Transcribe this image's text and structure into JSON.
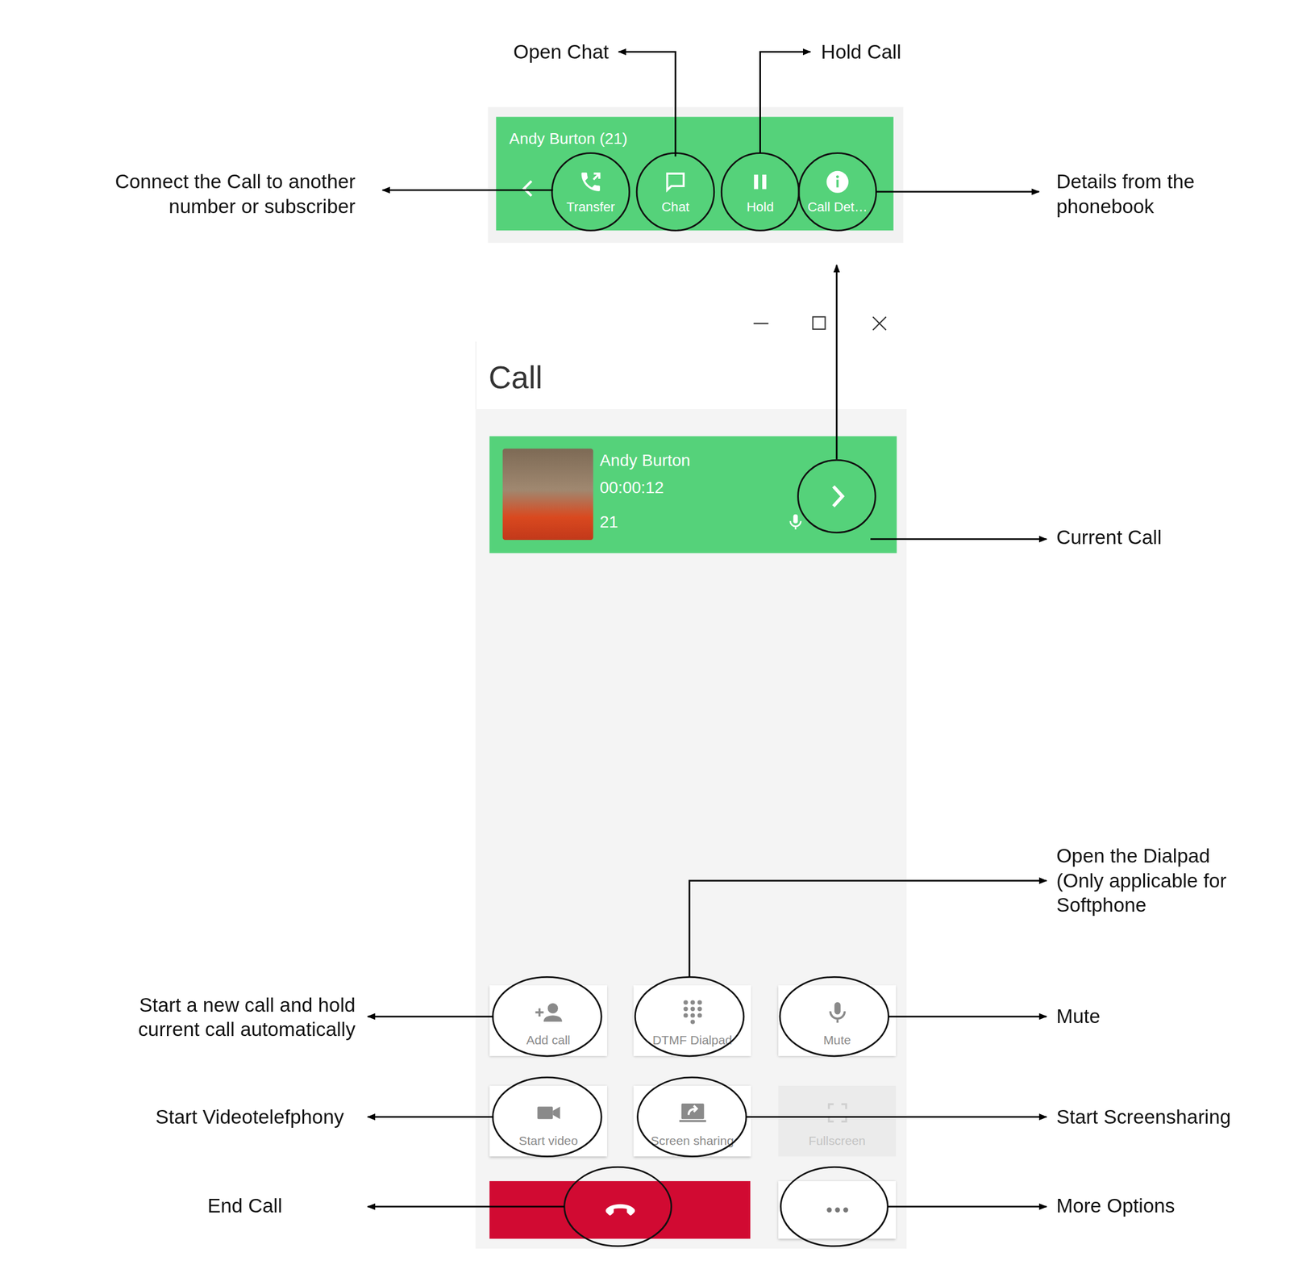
{
  "annotations": [
    {
      "lines": [
        "Open Chat"
      ]
    },
    {
      "lines": [
        "Hold Call"
      ]
    },
    {
      "lines": [
        "Connect the Call to another",
        "number or subscriber"
      ]
    },
    {
      "lines": [
        "Details from the",
        "phonebook"
      ]
    },
    {
      "lines": [
        "Current Call"
      ]
    },
    {
      "lines": [
        "Open the Dialpad",
        "(Only applicable for",
        "Softphone"
      ]
    },
    {
      "lines": [
        "Start a new call and hold",
        "current call automatically"
      ]
    },
    {
      "lines": [
        "Mute"
      ]
    },
    {
      "lines": [
        "Start Videotelefphony"
      ]
    },
    {
      "lines": [
        "Start Screensharing"
      ]
    },
    {
      "lines": [
        "End Call"
      ]
    },
    {
      "lines": [
        "More Options"
      ]
    }
  ],
  "toolbar": {
    "title": "Andy Burton (21)",
    "buttons": [
      {
        "label": "Transfer"
      },
      {
        "label": "Chat"
      },
      {
        "label": "Hold"
      },
      {
        "label": "Call Det…"
      }
    ]
  },
  "window": {
    "title": "Call"
  },
  "current_call": {
    "name": "Andy Burton",
    "duration": "00:00:12",
    "number": "21"
  },
  "actions": [
    {
      "label": "Add call",
      "disabled": false
    },
    {
      "label": "DTMF Dialpad",
      "disabled": false
    },
    {
      "label": "Mute",
      "disabled": false
    },
    {
      "label": "Start video",
      "disabled": false
    },
    {
      "label": "Screen sharing",
      "disabled": false
    },
    {
      "label": "Fullscreen",
      "disabled": true
    }
  ]
}
